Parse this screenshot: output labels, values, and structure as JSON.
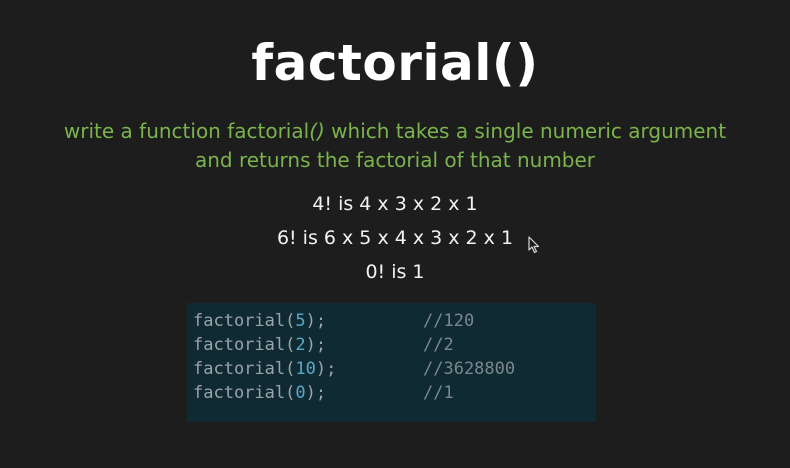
{
  "slide": {
    "title": "factorial()",
    "description": {
      "line1_before": "write a function factorial",
      "line1_paren": "()",
      "line1_after": " which takes a single numeric argument",
      "line2": "and returns the factorial of that number"
    },
    "examples": [
      "4! is 4 x 3 x 2 x 1",
      "6! is 6 x 5 x 4 x 3 x 2 x 1",
      "0! is 1"
    ],
    "code": [
      {
        "fn": "factorial(",
        "arg": "5",
        "end": ");",
        "comment": "//120"
      },
      {
        "fn": "factorial(",
        "arg": "2",
        "end": ");",
        "comment": "//2"
      },
      {
        "fn": "factorial(",
        "arg": "10",
        "end": ");",
        "comment": "//3628800"
      },
      {
        "fn": "factorial(",
        "arg": "0",
        "end": ");",
        "comment": "//1"
      }
    ]
  },
  "colors": {
    "background": "#1d1d1d",
    "title": "#ffffff",
    "description": "#7bb34c",
    "code_background": "#0f2a32"
  },
  "icons": {
    "cursor": "mouse-pointer-icon"
  }
}
